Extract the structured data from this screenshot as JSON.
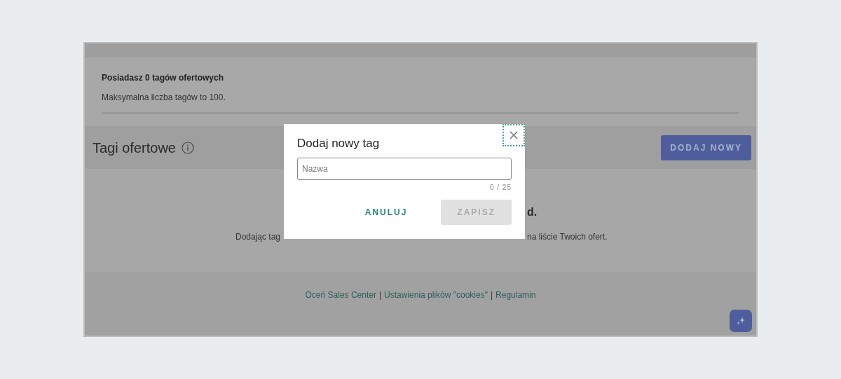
{
  "summary": {
    "title": "Posiadasz 0 tagów ofertowych",
    "text": "Maksymalna liczba tagów to 100."
  },
  "header": {
    "title": "Tagi ofertowe",
    "button": "DODAJ NOWY"
  },
  "empty_state": {
    "heading_tail": "d.",
    "text_start": "Dodając tag",
    "text_end": "na liście Twoich ofert."
  },
  "footer": {
    "links": [
      "Oceń Sales Center",
      "Ustawienia plików \"cookies\"",
      "Regulamin"
    ],
    "separator": "|"
  },
  "modal": {
    "title": "Dodaj nowy tag",
    "field": {
      "placeholder": "Nazwa"
    },
    "counter": "0 / 25",
    "buttons": [
      {
        "label": "ANULUJ",
        "disabled": false
      },
      {
        "label": "ZAPISZ",
        "disabled": true
      }
    ]
  }
}
